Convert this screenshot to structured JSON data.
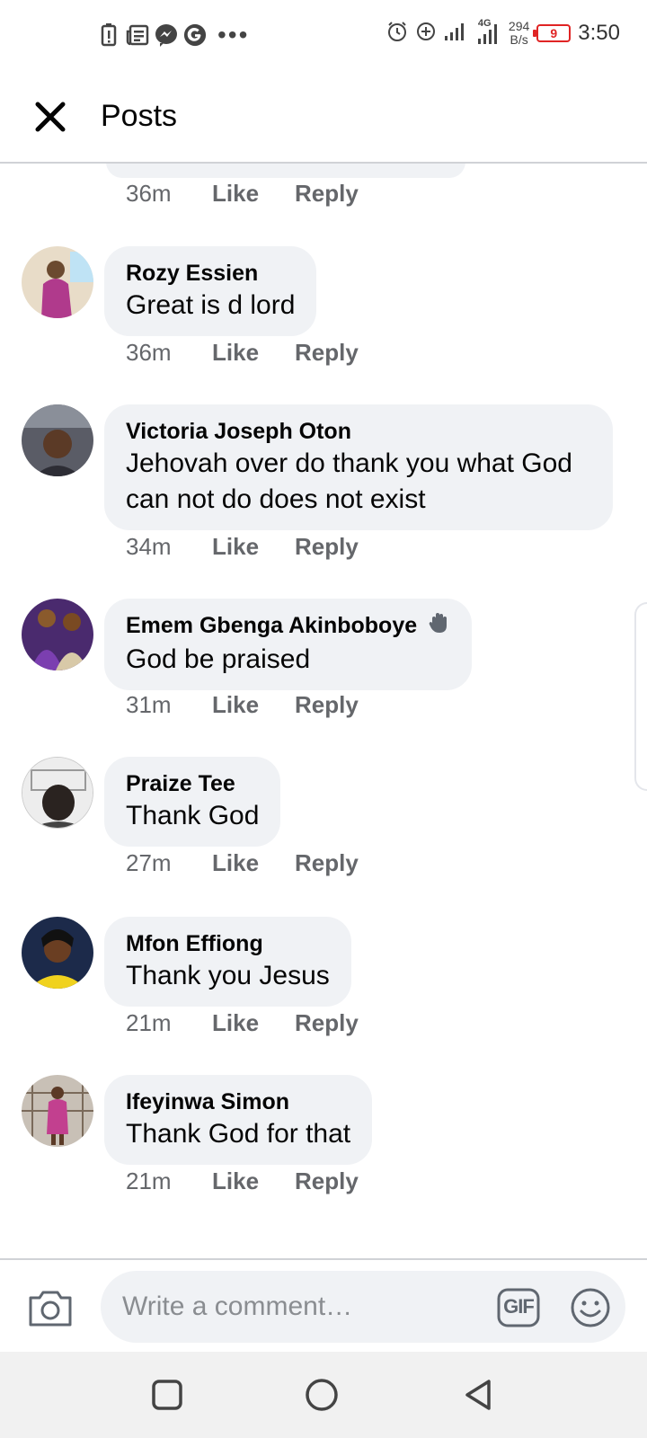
{
  "status_bar": {
    "speed_value": "294",
    "speed_unit": "B/s",
    "network": "4G",
    "battery": "9",
    "time": "3:50",
    "icons": [
      "battery-saver-icon",
      "news-icon",
      "messenger-icon",
      "google-icon",
      "more-dots-icon",
      "alarm-icon",
      "data-saver-icon",
      "signal-icon",
      "signal-4g-icon"
    ]
  },
  "header": {
    "title": "Posts",
    "close_icon": "close-icon"
  },
  "partial_comment": {
    "time": "36m",
    "like_label": "Like",
    "reply_label": "Reply"
  },
  "comments": [
    {
      "author": "Rozy Essien",
      "text": "Great is d lord",
      "time": "36m",
      "like_label": "Like",
      "reply_label": "Reply"
    },
    {
      "author": "Victoria Joseph Oton",
      "text": "Jehovah over do thank you what God can not do does not exist",
      "time": "34m",
      "like_label": "Like",
      "reply_label": "Reply"
    },
    {
      "author": "Emem Gbenga Akinboboye",
      "badge": "waving-hand-icon",
      "text": "God be praised",
      "time": "31m",
      "like_label": "Like",
      "reply_label": "Reply"
    },
    {
      "author": "Praize Tee",
      "text": "Thank God",
      "time": "27m",
      "like_label": "Like",
      "reply_label": "Reply"
    },
    {
      "author": "Mfon Effiong",
      "text": "Thank you Jesus",
      "time": "21m",
      "like_label": "Like",
      "reply_label": "Reply"
    },
    {
      "author": "Ifeyinwa Simon",
      "text": "Thank God for that",
      "time": "21m",
      "like_label": "Like",
      "reply_label": "Reply"
    }
  ],
  "composer": {
    "placeholder": "Write a comment…",
    "camera_icon": "camera-icon",
    "gif_label": "GIF",
    "emoji_icon": "emoji-icon"
  },
  "navbar": {
    "buttons": [
      "recents-square-icon",
      "home-circle-icon",
      "back-triangle-icon"
    ]
  },
  "colors": {
    "bubble": "#f0f2f5",
    "secondary_text": "#65676b",
    "primary_text": "#050505",
    "battery_low": "#e02424"
  }
}
